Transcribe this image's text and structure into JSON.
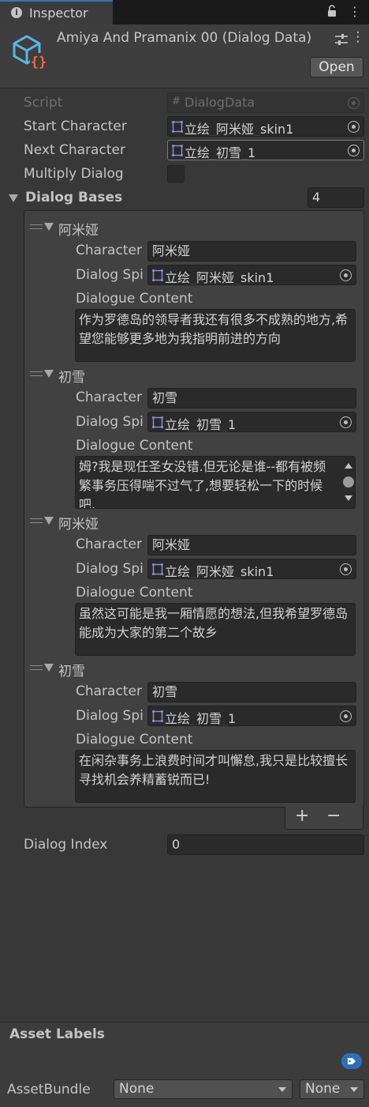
{
  "tab": {
    "title": "Inspector",
    "info_icon": "info-icon",
    "lock_icon": "lock-icon",
    "menu_icon": "kebab-menu-icon"
  },
  "header": {
    "title": "Amiya And Pramanix 00 (Dialog Data)",
    "open_label": "Open",
    "asset_icon": "scriptable-object-icon"
  },
  "fields": {
    "script": {
      "label": "Script",
      "value": "DialogData"
    },
    "start_character": {
      "label": "Start Character",
      "value": "立绘_阿米娅_skin1"
    },
    "next_character": {
      "label": "Next Character",
      "value": "立绘_初雪_1"
    },
    "multiply_dialog": {
      "label": "Multiply Dialog",
      "checked": false
    },
    "dialog_bases": {
      "label": "Dialog Bases",
      "count": "4"
    },
    "dialog_index": {
      "label": "Dialog Index",
      "value": "0"
    }
  },
  "element_labels": {
    "character": "Character",
    "sprite": "Dialog Spi",
    "content": "Dialogue Content"
  },
  "dialogs": [
    {
      "header": "阿米娅",
      "character": "阿米娅",
      "sprite": "立绘_阿米娅_skin1",
      "content": "作为罗德岛的领导者我还有很多不成熟的地方,希望您能够更多地为我指明前进的方向"
    },
    {
      "header": "初雪",
      "character": "初雪",
      "sprite": "立绘_初雪_1",
      "content": "姆?我是现任圣女没错.但无论是谁--都有被频繁事务压得喘不过气了,想要轻松一下的时候吧."
    },
    {
      "header": "阿米娅",
      "character": "阿米娅",
      "sprite": "立绘_阿米娅_skin1",
      "content": "虽然这可能是我一厢情愿的想法,但我希望罗德岛能成为大家的第二个故乡"
    },
    {
      "header": "初雪",
      "character": "初雪",
      "sprite": "立绘_初雪_1",
      "content": "在闲杂事务上浪费时间才叫懈怠,我只是比较擅长寻找机会养精蓄锐而已!"
    }
  ],
  "list_footer": {
    "add": "+",
    "remove": "−"
  },
  "asset_labels": {
    "title": "Asset Labels",
    "assetbundle_label": "AssetBundle",
    "bundle_name": "None",
    "bundle_variant": "None"
  },
  "colors": {
    "background": "#383838",
    "field": "#2a2a2a",
    "accent": "#2e6fb8",
    "text": "#c4c4c4"
  }
}
